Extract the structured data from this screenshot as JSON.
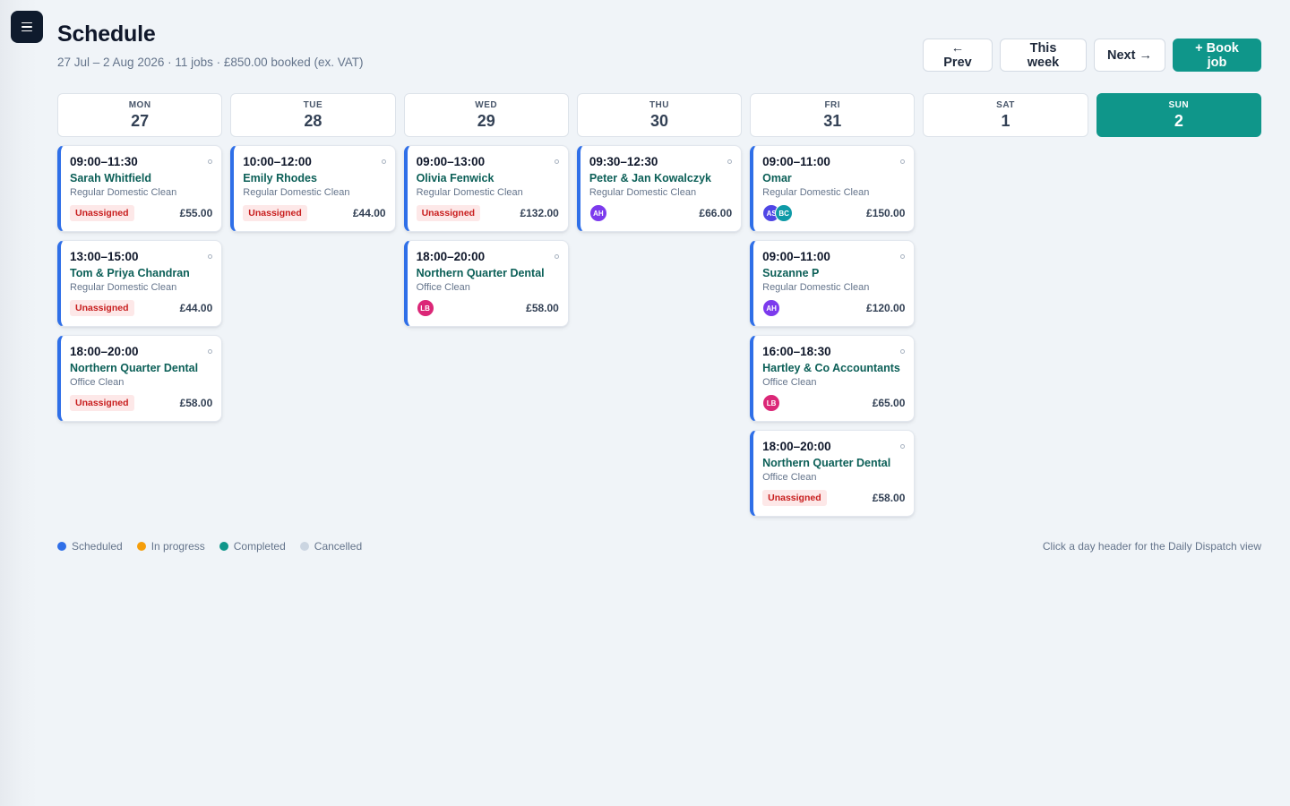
{
  "page": {
    "title": "Schedule",
    "subtitle": "27 Jul – 2 Aug 2026 · 11 jobs · £850.00 booked (ex. VAT)"
  },
  "toolbar": {
    "prev_label": "← Prev",
    "this_week_label": "This week",
    "next_label": "Next →",
    "book_label": "+ Book job"
  },
  "colors": {
    "scheduled": "#2f6fe8",
    "in_progress": "#f59e0b",
    "completed": "#0f968a",
    "cancelled": "#cbd5e1",
    "unassigned_text": "#c81e1e",
    "unassigned_bg": "#fde8e8"
  },
  "days": [
    {
      "dow": "MON",
      "num": "27",
      "today": false,
      "jobs": [
        {
          "time": "09:00–11:30",
          "client": "Sarah Whitfield",
          "service": "Regular Domestic Clean",
          "status": "scheduled",
          "unassigned": "Unassigned",
          "price": "£55.00",
          "staff": []
        },
        {
          "time": "13:00–15:00",
          "client": "Tom & Priya Chandran",
          "service": "Regular Domestic Clean",
          "status": "scheduled",
          "unassigned": "Unassigned",
          "price": "£44.00",
          "staff": []
        },
        {
          "time": "18:00–20:00",
          "client": "Northern Quarter Dental",
          "service": "Office Clean",
          "status": "scheduled",
          "unassigned": "Unassigned",
          "price": "£58.00",
          "staff": []
        }
      ]
    },
    {
      "dow": "TUE",
      "num": "28",
      "today": false,
      "jobs": [
        {
          "time": "10:00–12:00",
          "client": "Emily Rhodes",
          "service": "Regular Domestic Clean",
          "status": "scheduled",
          "unassigned": "Unassigned",
          "price": "£44.00",
          "staff": []
        }
      ]
    },
    {
      "dow": "WED",
      "num": "29",
      "today": false,
      "jobs": [
        {
          "time": "09:00–13:00",
          "client": "Olivia Fenwick",
          "service": "Regular Domestic Clean",
          "status": "scheduled",
          "unassigned": "Unassigned",
          "price": "£132.00",
          "staff": []
        },
        {
          "time": "18:00–20:00",
          "client": "Northern Quarter Dental",
          "service": "Office Clean",
          "status": "scheduled",
          "unassigned": "",
          "price": "£58.00",
          "staff": [
            {
              "initials": "LB",
              "color": "#db2777"
            }
          ]
        }
      ]
    },
    {
      "dow": "THU",
      "num": "30",
      "today": false,
      "jobs": [
        {
          "time": "09:30–12:30",
          "client": "Peter & Jan Kowalczyk",
          "service": "Regular Domestic Clean",
          "status": "scheduled",
          "unassigned": "",
          "price": "£66.00",
          "staff": [
            {
              "initials": "AH",
              "color": "#7c3aed"
            }
          ]
        }
      ]
    },
    {
      "dow": "FRI",
      "num": "31",
      "today": false,
      "jobs": [
        {
          "time": "09:00–11:00",
          "client": "Omar",
          "service": "Regular Domestic Clean",
          "status": "scheduled",
          "unassigned": "",
          "price": "£150.00",
          "staff": [
            {
              "initials": "AS",
              "color": "#4f46e5"
            },
            {
              "initials": "BC",
              "color": "#0e9aa7"
            }
          ]
        },
        {
          "time": "09:00–11:00",
          "client": "Suzanne P",
          "service": "Regular Domestic Clean",
          "status": "scheduled",
          "unassigned": "",
          "price": "£120.00",
          "staff": [
            {
              "initials": "AH",
              "color": "#7c3aed"
            }
          ]
        },
        {
          "time": "16:00–18:30",
          "client": "Hartley & Co Accountants",
          "service": "Office Clean",
          "status": "scheduled",
          "unassigned": "",
          "price": "£65.00",
          "staff": [
            {
              "initials": "LB",
              "color": "#db2777"
            }
          ]
        },
        {
          "time": "18:00–20:00",
          "client": "Northern Quarter Dental",
          "service": "Office Clean",
          "status": "scheduled",
          "unassigned": "Unassigned",
          "price": "£58.00",
          "staff": []
        }
      ]
    },
    {
      "dow": "SAT",
      "num": "1",
      "today": false,
      "jobs": []
    },
    {
      "dow": "SUN",
      "num": "2",
      "today": true,
      "jobs": []
    }
  ],
  "legend": [
    {
      "label": "Scheduled",
      "color": "#2f6fe8"
    },
    {
      "label": "In progress",
      "color": "#f59e0b"
    },
    {
      "label": "Completed",
      "color": "#0f968a"
    },
    {
      "label": "Cancelled",
      "color": "#cbd5e1"
    }
  ],
  "hint": "Click a day header for the Daily Dispatch view"
}
